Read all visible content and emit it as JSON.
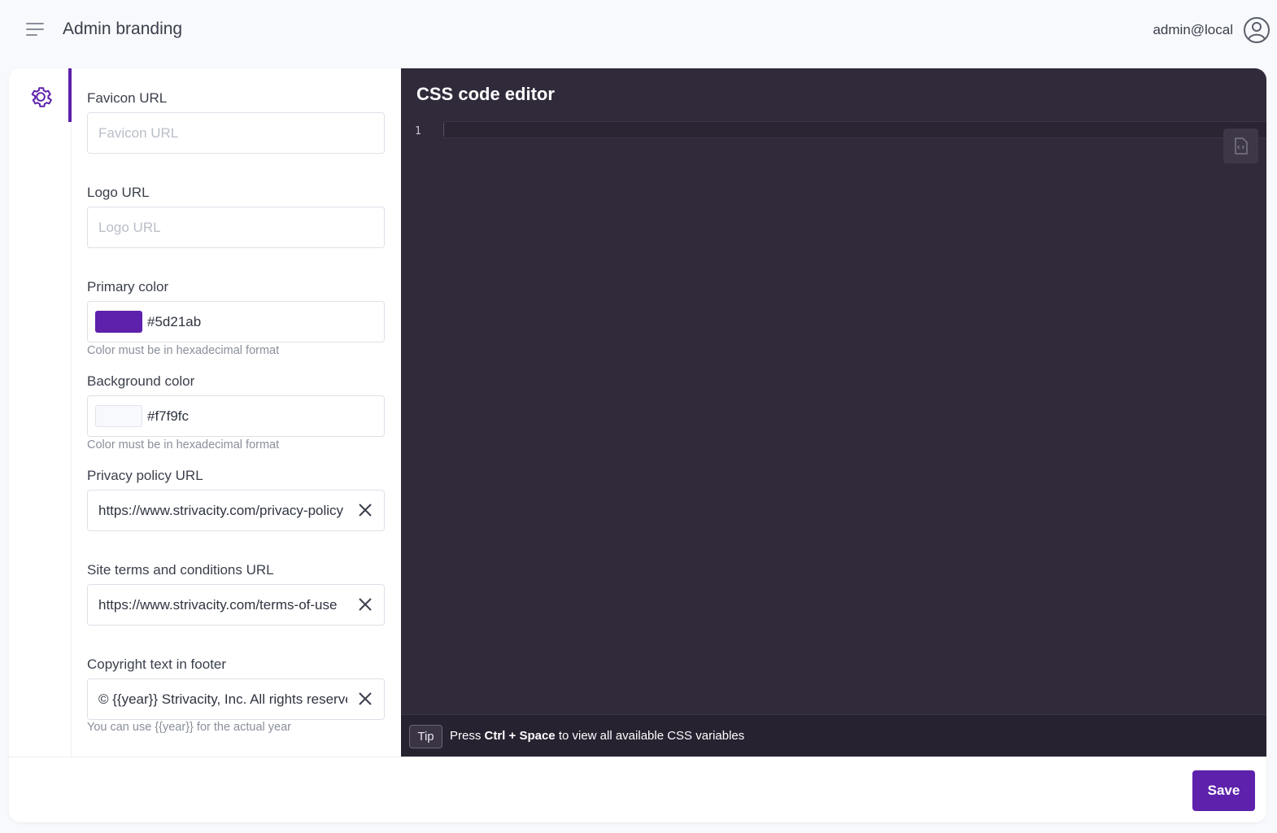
{
  "header": {
    "title": "Admin branding",
    "user_email": "admin@local"
  },
  "icons": {
    "menu": "hamburger-menu-icon",
    "user": "user-circle-icon",
    "settings": "gear-icon",
    "clear": "close-icon",
    "format": "file-code-icon"
  },
  "colors": {
    "accent": "#5d21ab",
    "page_background": "#f7f9fc",
    "editor_background": "#302a3a"
  },
  "form": {
    "favicon": {
      "label": "Favicon URL",
      "placeholder": "Favicon URL",
      "value": ""
    },
    "logo": {
      "label": "Logo URL",
      "placeholder": "Logo URL",
      "value": ""
    },
    "primary_color": {
      "label": "Primary color",
      "value": "#5d21ab",
      "helper": "Color must be in hexadecimal format"
    },
    "background_color": {
      "label": "Background color",
      "value": "#f7f9fc",
      "helper": "Color must be in hexadecimal format"
    },
    "privacy": {
      "label": "Privacy policy URL",
      "value": "https://www.strivacity.com/privacy-policy"
    },
    "terms": {
      "label": "Site terms and conditions URL",
      "value": "https://www.strivacity.com/terms-of-use"
    },
    "copyright": {
      "label": "Copyright text in footer",
      "value": "© {{year}} Strivacity, Inc. All rights reserved.",
      "helper": "You can use {{year}} for the actual year"
    }
  },
  "editor": {
    "title": "CSS code editor",
    "line_number": "1",
    "content": "",
    "tip_badge": "Tip",
    "tip_prefix": "Press",
    "tip_keys": "Ctrl + Space",
    "tip_suffix": "to view all available CSS variables"
  },
  "footer": {
    "save_label": "Save"
  }
}
